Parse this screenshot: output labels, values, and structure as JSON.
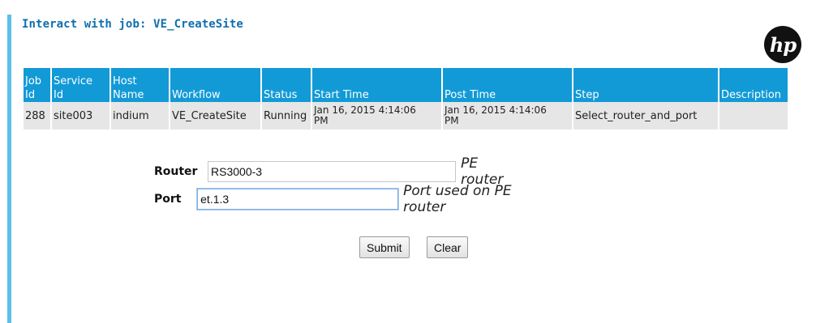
{
  "header": {
    "title": "Interact with job: VE_CreateSite",
    "logo_text": "hp"
  },
  "table": {
    "columns": [
      [
        "Job",
        "Id"
      ],
      [
        "Service",
        "Id"
      ],
      [
        "Host",
        "Name"
      ],
      [
        "Workflow"
      ],
      [
        "Status"
      ],
      [
        "Start Time"
      ],
      [
        "Post Time"
      ],
      [
        "Step"
      ],
      [
        "Description"
      ]
    ],
    "row": {
      "job_id": "288",
      "service_id": "site003",
      "host_name": "indium",
      "workflow": "VE_CreateSite",
      "status": "Running",
      "start_time": [
        "Jan 16, 2015 4:14:06",
        "PM"
      ],
      "post_time": [
        "Jan 16, 2015 4:14:06",
        "PM"
      ],
      "step": "Select_router_and_port",
      "description": ""
    }
  },
  "form": {
    "router": {
      "label": "Router",
      "value": "RS3000-3",
      "hint": "PE router"
    },
    "port": {
      "label": "Port",
      "value": "et.1.3",
      "hint": "Port used on PE router"
    }
  },
  "buttons": {
    "submit": "Submit",
    "clear": "Clear"
  },
  "colors": {
    "accent_bar": "#5bc0e8",
    "header_bg": "#129ad7",
    "title": "#0f6fae",
    "row_bg": "#e6e6e6"
  }
}
